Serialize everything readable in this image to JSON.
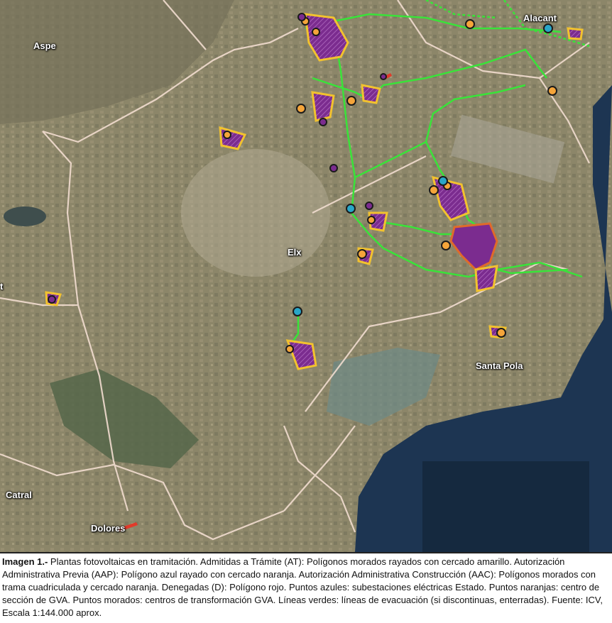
{
  "map": {
    "places": {
      "aspe": "Aspe",
      "alacant": "Alacant",
      "elx": "Elx",
      "santa_pola": "Santa Pola",
      "catral": "Catral",
      "dolores": "Dolores",
      "left_edge": "t"
    },
    "colors": {
      "land": "#8c8669",
      "sea": "#1d3552",
      "roads": "#f2ddd0",
      "evacuation_lines": "#39e339",
      "at_polygons": "#7b2c8f",
      "at_fence": "#f2c22e",
      "aac_fence": "#e06a2a",
      "denied": "#e23a2a",
      "substation_points": "#29a6c8",
      "section_points": "#f5a53a",
      "transform_points": "#7b2c8f"
    }
  },
  "caption": {
    "title": "Imagen 1.-",
    "text": "Plantas fotovoltaicas en tramitación. Admitidas a Trámite (AT): Polígonos morados rayados con cercado amarillo. Autorización Administrativa Previa (AAP): Polígono azul rayado con cercado naranja. Autorización Administrativa Construcción (AAC): Polígonos morados con trama cuadriculada y cercado naranja. Denegadas (D): Polígono rojo. Puntos azules: subestaciones eléctricas Estado. Puntos naranjas: centro de sección de GVA. Puntos morados: centros de transformación GVA. Líneas verdes: líneas de evacuación (si discontinuas, enterradas). Fuente: ICV, Escala 1:144.000 aprox."
  }
}
